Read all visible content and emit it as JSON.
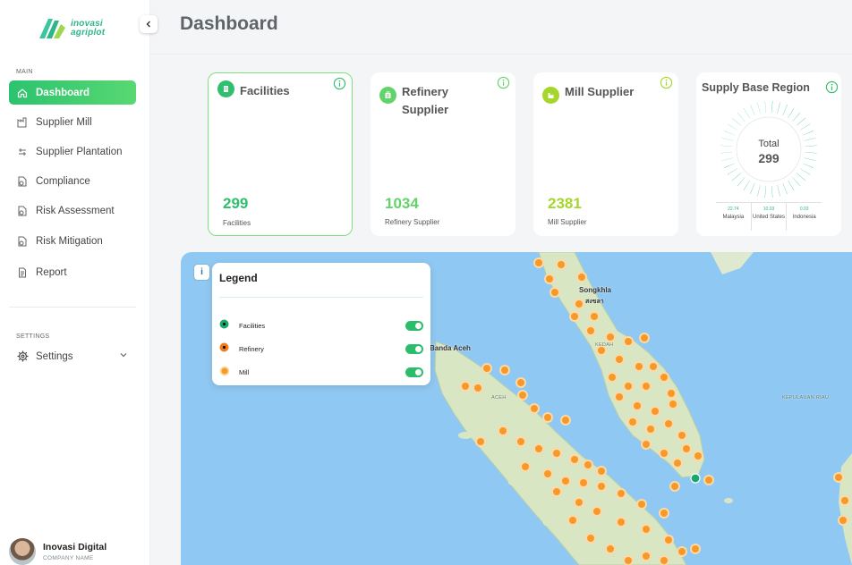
{
  "brand": {
    "line1": "inovasi",
    "line2": "agriplot"
  },
  "header": {
    "title": "Dashboard"
  },
  "sidebar": {
    "main_label": "MAIN",
    "items": [
      {
        "label": "Dashboard",
        "icon": "home-icon",
        "active": true
      },
      {
        "label": "Supplier Mill",
        "icon": "factory-icon"
      },
      {
        "label": "Supplier Plantation",
        "icon": "plantation-icon"
      },
      {
        "label": "Compliance",
        "icon": "shield-doc-icon"
      },
      {
        "label": "Risk Assessment",
        "icon": "shield-doc-icon"
      },
      {
        "label": "Risk Mitigation",
        "icon": "shield-doc-icon"
      },
      {
        "label": "Report",
        "icon": "document-icon"
      }
    ],
    "settings_label": "SETTINGS",
    "settings_item": {
      "label": "Settings",
      "icon": "gear-icon"
    },
    "user": {
      "name": "Inovasi Digital",
      "company": "COMPANY NAME"
    }
  },
  "cards": {
    "facilities": {
      "title": "Facilities",
      "value": "299",
      "sub": "Facilities",
      "color": "#2fbf6e"
    },
    "refinery": {
      "title": "Refinery Supplier",
      "value": "1034",
      "sub": "Refinery Supplier",
      "color": "#62d36a"
    },
    "mill": {
      "title": "Mill Supplier",
      "value": "2381",
      "sub": "Mill Supplier",
      "color": "#a6d62c"
    },
    "region": {
      "title": "Supply Base Region",
      "total_label": "Total",
      "total_value": "299",
      "regions": [
        {
          "pct": "22.74",
          "name": "Malaysia",
          "color": "#1fb981"
        },
        {
          "pct": "10.03",
          "name": "United States",
          "color": "#63dcae"
        },
        {
          "pct": "0.03",
          "name": "Indonesia",
          "color": "#aef0d6"
        }
      ]
    }
  },
  "map": {
    "info_button": "i",
    "legend_title": "Legend",
    "legend_items": [
      {
        "label": "Facilities",
        "color": "#18a86b",
        "enabled": true
      },
      {
        "label": "Refinery",
        "color": "#f07d1a",
        "enabled": true
      },
      {
        "label": "Mill",
        "color": "#f59a2a",
        "enabled": true
      }
    ],
    "labels": {
      "songkhla": "Songkhla",
      "songkhla_local": "สงขลา",
      "banda_aceh": "Banda Aceh",
      "aceh": "ACEH",
      "kedah": "KEDAH",
      "riau": "KEPULAUAN RIAU"
    }
  }
}
